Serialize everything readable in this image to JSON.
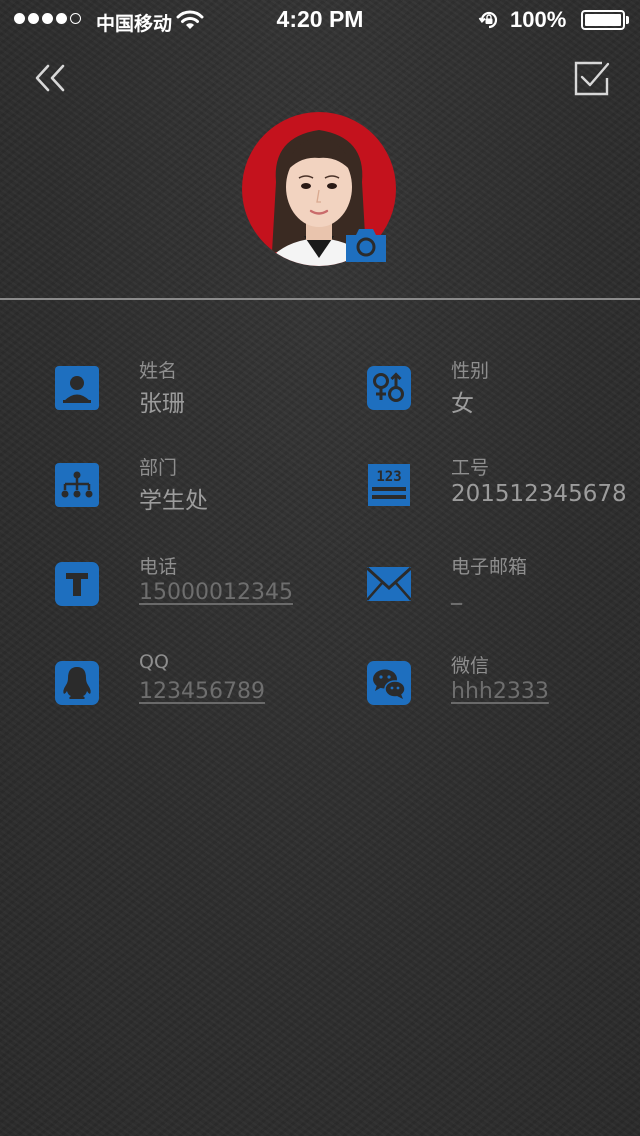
{
  "status_bar": {
    "carrier": "中国移动",
    "time": "4:20 PM",
    "battery_percent": "100%",
    "battery_level": 1.0,
    "signal_strength": 4,
    "signal_max": 5,
    "icons": [
      "wifi-icon",
      "rotation-lock-icon",
      "battery-icon"
    ]
  },
  "header": {
    "icons": [
      "double-chevron-left-icon",
      "checkbox-check-icon",
      "camera-icon"
    ]
  },
  "colors": {
    "accent": "#1e6fbf",
    "background": "#2f2f2f",
    "divider": "#8a8a8a",
    "avatar_bg": "#c4121d"
  },
  "fields": [
    {
      "key": "name",
      "label": "姓名",
      "value": "张珊",
      "icon": "user-icon",
      "link": false
    },
    {
      "key": "gender",
      "label": "性别",
      "value": "女",
      "icon": "gender-icon",
      "link": false
    },
    {
      "key": "department",
      "label": "部门",
      "value": "学生处",
      "icon": "org-chart-icon",
      "link": false
    },
    {
      "key": "employee_id",
      "label": "工号",
      "value": "201512345678",
      "icon": "id-number-icon",
      "link": false
    },
    {
      "key": "phone",
      "label": "电话",
      "value": "15000012345",
      "icon": "phone-t-icon",
      "link": true
    },
    {
      "key": "email",
      "label": "电子邮箱",
      "value": "_",
      "icon": "mail-icon",
      "link": true
    },
    {
      "key": "qq",
      "label": "QQ",
      "value": "123456789",
      "icon": "qq-penguin-icon",
      "link": true
    },
    {
      "key": "wechat",
      "label": "微信",
      "value": "hhh2333",
      "icon": "wechat-icon",
      "link": true
    }
  ]
}
